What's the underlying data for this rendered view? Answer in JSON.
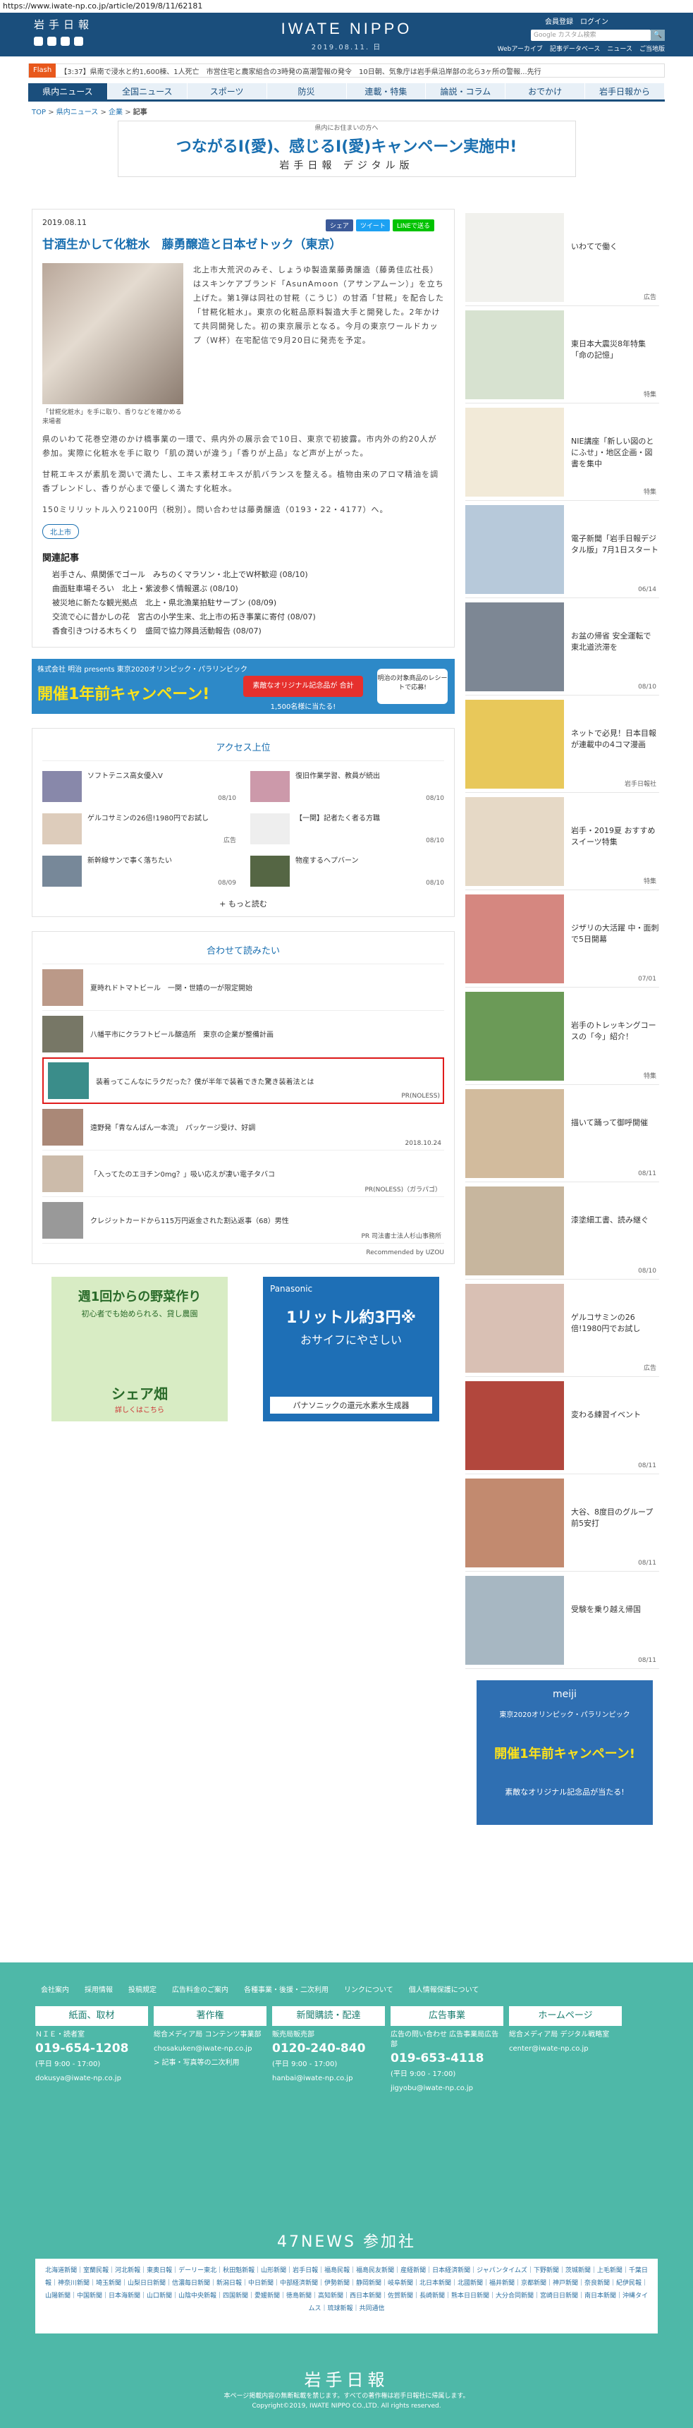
{
  "url": "https://www.iwate-np.co.jp/article/2019/8/11/62181",
  "header": {
    "logo_small": "岩手日報",
    "brand": "IWATE NIPPO",
    "date": "2019.08.11. 日",
    "links": [
      "会員登録",
      "ログイン"
    ],
    "search_placeholder": "Google カスタム検索",
    "nav": [
      "Webアーカイブ",
      "記事データベース",
      "ニュース",
      "ご当地版"
    ]
  },
  "flash": {
    "tag": "Flash",
    "text": "【3:37】県南で浸水と約1,600棟、1人死亡　市営住宅と農家組合の3時発の高潮警報の発令　10日朝、気象庁は岩手県沿岸部の北ら3ヶ所の警報...先行"
  },
  "mainnav": [
    "県内ニュース",
    "全国ニュース",
    "スポーツ",
    "防災",
    "連載・特集",
    "論説・コラム",
    "おでかけ",
    "岩手日報から"
  ],
  "breadcrumb": [
    "TOP",
    "県内ニュース",
    "企業",
    "記事"
  ],
  "banner": {
    "small": "県内にお住まいの方へ",
    "main": "つながるⅠ(愛)、感じるⅠ(愛)キャンペーン実施中!",
    "sub": "岩手日報 デジタル版"
  },
  "article": {
    "date": "2019.08.11",
    "share": [
      "シェア",
      "ツイート",
      "LINEで送る"
    ],
    "title": "甘酒生かして化粧水　藤勇醸造と日本ゼトック（東京）",
    "caption": "「甘糀化粧水」を手に取り、香りなどを確かめる来場者",
    "p1": "北上市大荒沢のみそ、しょうゆ製造業藤勇醸造（藤勇佳広社長）はスキンケアブランド「AsunAmoon（アサンアムーン）」を立ち上げた。第1弾は同社の甘糀（こうじ）の甘酒「甘糀」を配合した「甘糀化粧水」。東京の化粧品原料製造大手と開発した。2年かけて共同開発した。初の東京展示となる。今月の東京ワールドカップ（W杯）在宅配信で9月20日に発売を予定。",
    "p2": "県のいわて花巻空港のかけ橋事業の一環で、県内外の展示会で10日、東京で初披露。市内外の約20人が参加。実際に化粧水を手に取り「肌の潤いが違う」「香りが上品」など声が上がった。",
    "p3": "甘糀エキスが素肌を潤いで満たし、エキス素材エキスが肌バランスを整える。植物由来のアロマ精油を調香ブレンドし、香りが心まで優しく満たす化粧水。",
    "p4": "150ミリリットル入り2100円（税別）。問い合わせは藤勇醸造（0193・22・4177）へ。",
    "tag": "北上市",
    "related_heading": "関連記事",
    "related": [
      "岩手さん、県関係でゴール　みちのくマラソン・北上でW杯歓迎 (08/10)",
      "曲面駐車場そろい　北上・紫波参く情報選ぶ (08/10)",
      "被災地に新たな観光拠点　北上・県北漁業拍駐サーブン (08/09)",
      "交流で心に昔かしの花　宮古の小学生来、北上市の拓き事業に寄付 (08/07)",
      "香食引きつける木ちくり　盛岡で協力隊員活動報告 (08/07)"
    ]
  },
  "ad_wide": {
    "line1": "株式会社 明治 presents 東京2020オリンピック・パラリンピック",
    "line2": "開催1年前キャンペーン!",
    "line3": "素敵なオリジナル記念品が 合計1,500名様に当たる!",
    "line4": "明治の対象商品のレシートで応募!"
  },
  "ranking": {
    "heading": "アクセス上位",
    "items": [
      {
        "title": "ソフトテニス高女優入V",
        "date": "08/10"
      },
      {
        "title": "復旧作業学習、教員が続出",
        "date": "08/10"
      },
      {
        "title": "ゲルコサミンの26倍!1980円でお試し",
        "date": "広告"
      },
      {
        "title": "【一関】記者たく者る方職",
        "date": "08/10"
      },
      {
        "title": "新幹線サンで事く落ちたい",
        "date": "08/09"
      },
      {
        "title": "物産するヘプバーン",
        "date": "08/10"
      }
    ],
    "more": "もっと読む"
  },
  "recommend": {
    "heading": "合わせて読みたい",
    "items": [
      {
        "title": "夏時れドトマトビール　一関・世嬉の一が限定開始",
        "source": ""
      },
      {
        "title": "八幡平市にクラフトビール醸造所　東京の企業が整備計画",
        "source": ""
      },
      {
        "title": "装着ってこんなにラクだった？僕が半年で装着できた驚き装着法とは",
        "source": "PR(NOLESS)"
      },
      {
        "title": "遠野発「青なんばん一本流」　パッケージ受け、好調",
        "source": "2018.10.24"
      },
      {
        "title": "「入ってたのエヨチン0mg？」吸い応えが凄い電子タバコ",
        "source": "PR(NOLESS)（ガラパゴ）"
      },
      {
        "title": "クレジットカードから115万円返金された割込返事（68）男性",
        "source": "PR 司法書士法人杉山事務所"
      }
    ],
    "attribution": "Recommended by UZOU"
  },
  "ads": {
    "left": {
      "l1": "週1回からの野菜作り",
      "l2": "初心者でも始められる、貸し農園",
      "l3": "シェア畑",
      "l4": "詳しくはこちら"
    },
    "right": {
      "l1": "Panasonic",
      "l2": "1リットル約3円※",
      "l3": "おサイフにやさしい",
      "l4": "パナソニックの還元水素水生成器"
    }
  },
  "sidebar": [
    {
      "title": "いわてで働く",
      "date": "広告",
      "color": "#f1f1ed"
    },
    {
      "title": "東日本大震災8年特集「命の記憶」",
      "date": "特集",
      "color": "#d7e2d0"
    },
    {
      "title": "NIE講座「新しい図のとにふせ」・地区企画・図書を集中",
      "date": "特集",
      "color": "#f2ead8"
    },
    {
      "title": "電子新聞「岩手日報デジタル版」7月1日スタート",
      "date": "06/14",
      "color": "#b7c9da"
    },
    {
      "title": "お盆の帰省 安全運転で 東北道渋滞を",
      "date": "08/10",
      "color": "#7d8794"
    },
    {
      "title": "ネットで必見！日本目報が連載中の4コマ漫画",
      "date": "岩手日報社",
      "color": "#e8c85a"
    },
    {
      "title": "岩手・2019夏 おすすめスイーツ特集",
      "date": "特集",
      "color": "#e6d9c6"
    },
    {
      "title": "ジザリの大活躍 中・面刺で5日開幕",
      "date": "07/01",
      "color": "#d58780"
    },
    {
      "title": "岩手のトレッキングコースの「今」紹介！",
      "date": "特集",
      "color": "#6b9a57"
    },
    {
      "title": "描いて踊って御呼開催",
      "date": "08/11",
      "color": "#d2bb9d"
    },
    {
      "title": "漆塗細工書、読み継ぐ",
      "date": "08/10",
      "color": "#c7b69e"
    },
    {
      "title": "ゲルコサミンの26倍!1980円でお試し",
      "date": "広告",
      "color": "#d9c0b4"
    },
    {
      "title": "変わる練習イベント",
      "date": "08/11",
      "color": "#b2473d"
    },
    {
      "title": "大谷、8度目のグループ前5安打",
      "date": "08/11",
      "color": "#c28a6f"
    },
    {
      "title": "受験を乗り越え帰国",
      "date": "08/11",
      "color": "#a7b7c2"
    }
  ],
  "side_ad": {
    "l1": "meiji",
    "l2": "東京2020オリンピック・パラリンピック",
    "l3": "開催1年前キャンペーン!",
    "l4": "素敵なオリジナル記念品が当たる!"
  },
  "footer": {
    "links": [
      "会社案内",
      "採用情報",
      "投稿規定",
      "広告料金のご案内",
      "各種事業・後援・二次利用",
      "リンクについて",
      "個人情報保護について"
    ],
    "cols": [
      {
        "h": "紙面、取材",
        "l1": "ＮＩＥ・読者室",
        "big": "019-654-1208",
        "l2": "(平日 9:00 - 17:00)",
        "l3": "dokusya@iwate-np.co.jp"
      },
      {
        "h": "著作権",
        "l1": "総合メディア局 コンテンツ事業部",
        "big": "",
        "l2": "chosakuken@iwate-np.co.jp",
        "l3": "> 記事・写真等の二次利用"
      },
      {
        "h": "新聞購読・配達",
        "l1": "販売局販売部",
        "big": "0120-240-840",
        "l2": "(平日 9:00 - 17:00)",
        "l3": "hanbai@iwate-np.co.jp"
      },
      {
        "h": "広告事業",
        "l1": "広告の問い合わせ 広告事業局広告部",
        "big": "019-653-4118",
        "l2": "(平日 9:00 - 17:00)",
        "l3": "jigyobu@iwate-np.co.jp"
      },
      {
        "h": "ホームページ",
        "l1": "総合メディア局 デジタル戦略室",
        "big": "",
        "l2": "center@iwate-np.co.jp",
        "l3": ""
      }
    ],
    "news47": "47NEWS 参加社",
    "members": "北海道新聞｜室蘭民報｜河北新報｜東奥日報｜デーリー東北｜秋田魁新報｜山形新聞｜岩手日報｜福島民報｜福島民友新聞｜産経新聞｜日本経済新聞｜ジャパンタイムズ｜下野新聞｜茨城新聞｜上毛新聞｜千葉日報｜神奈川新聞｜埼玉新聞｜山梨日日新聞｜信濃毎日新聞｜新潟日報｜中日新聞｜中部経済新聞｜伊勢新聞｜静岡新聞｜岐阜新聞｜北日本新聞｜北國新聞｜福井新聞｜京都新聞｜神戸新聞｜奈良新聞｜紀伊民報｜山陽新聞｜中国新聞｜日本海新聞｜山口新聞｜山陰中央新報｜四国新聞｜愛媛新聞｜徳島新聞｜高知新聞｜西日本新聞｜佐賀新聞｜長崎新聞｜熊本日日新聞｜大分合同新聞｜宮崎日日新聞｜南日本新聞｜沖縄タイムス｜琉球新報｜共同通信",
    "logo": "岩手日報",
    "copy1": "本ページ掲載内容の無断転載を禁じます。すべての著作権は岩手日報社に帰属します。",
    "copy2": "Copyright©2019, IWATE NIPPO CO.,LTD. All rights reserved."
  }
}
